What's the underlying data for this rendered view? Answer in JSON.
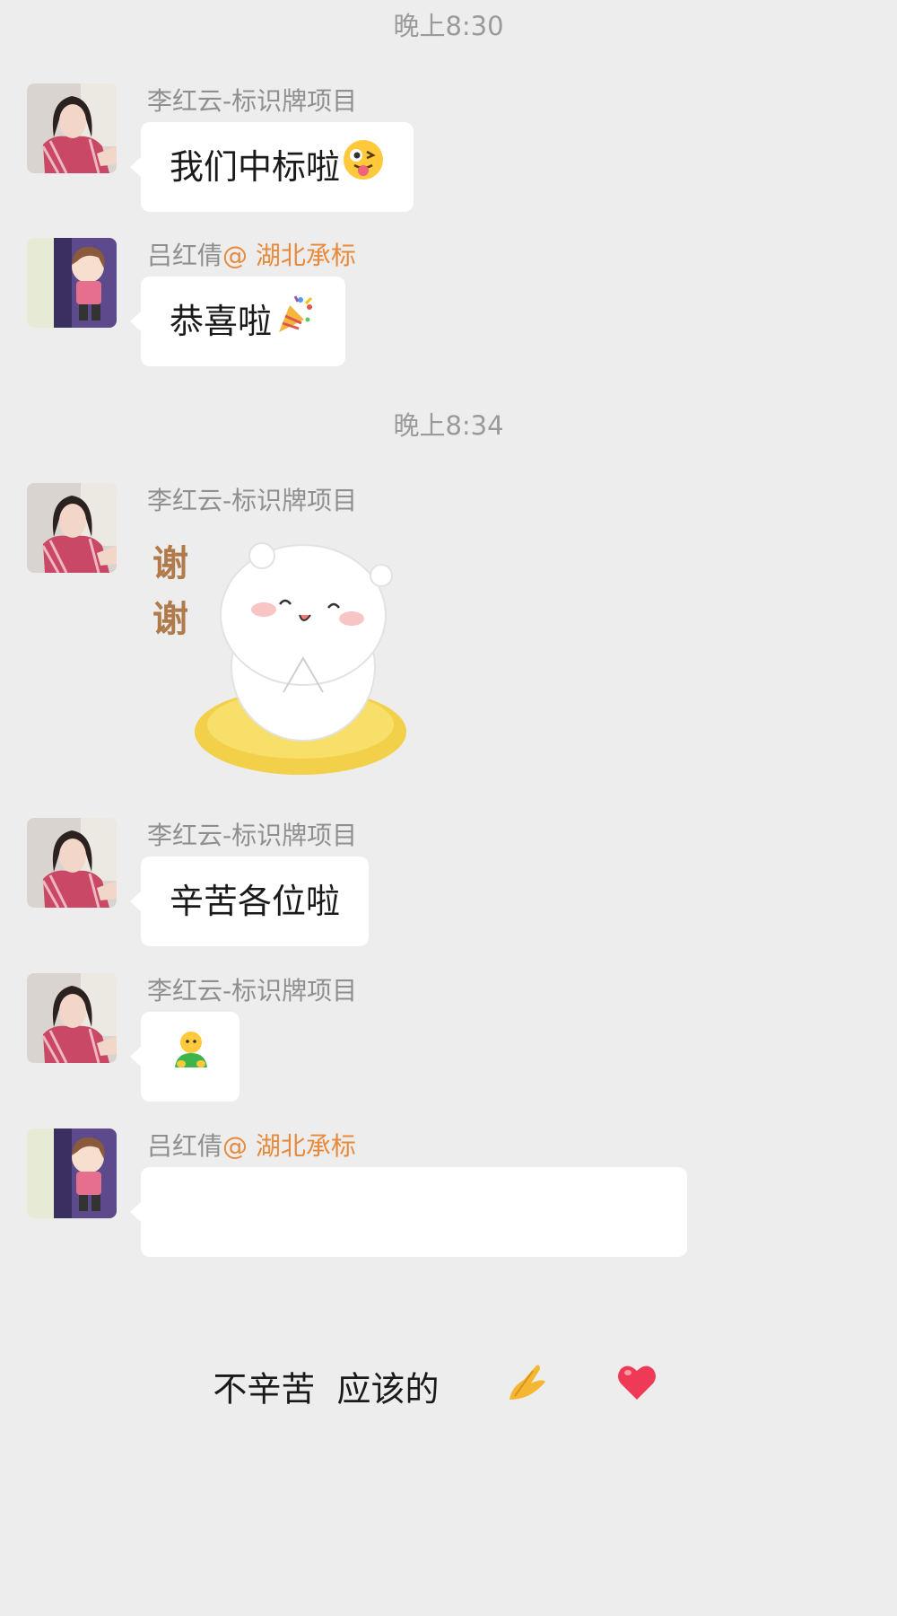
{
  "timestamps": [
    "晚上8:30",
    "晚上8:34"
  ],
  "messages": [
    {
      "sender_name": "李红云-标识牌项目",
      "text": "我们中标啦",
      "emoji": "winking-tongue-emoji"
    },
    {
      "sender_name": "吕红倩",
      "sender_tag": "@ 湖北承标",
      "text": "恭喜啦",
      "emoji": "party-popper-emoji"
    },
    {
      "sender_name": "李红云-标识牌项目",
      "sticker_text": "谢谢",
      "sticker": "bear-thanks-sticker"
    },
    {
      "sender_name": "李红云-标识牌项目",
      "text": "辛苦各位啦"
    },
    {
      "sender_name": "李红云-标识牌项目",
      "emoji": "bowing-person-emoji"
    },
    {
      "sender_name": "吕红倩",
      "sender_tag": "@ 湖北承标",
      "text": "不辛苦  应该的",
      "emoji": "praying-hands-emoji, red-heart-emoji"
    }
  ],
  "colors": {
    "background": "#ededed",
    "bubble": "#ffffff",
    "timestamp": "#9a9a9a",
    "sender": "#8f8f8f",
    "company_tag": "#e88a3c"
  }
}
